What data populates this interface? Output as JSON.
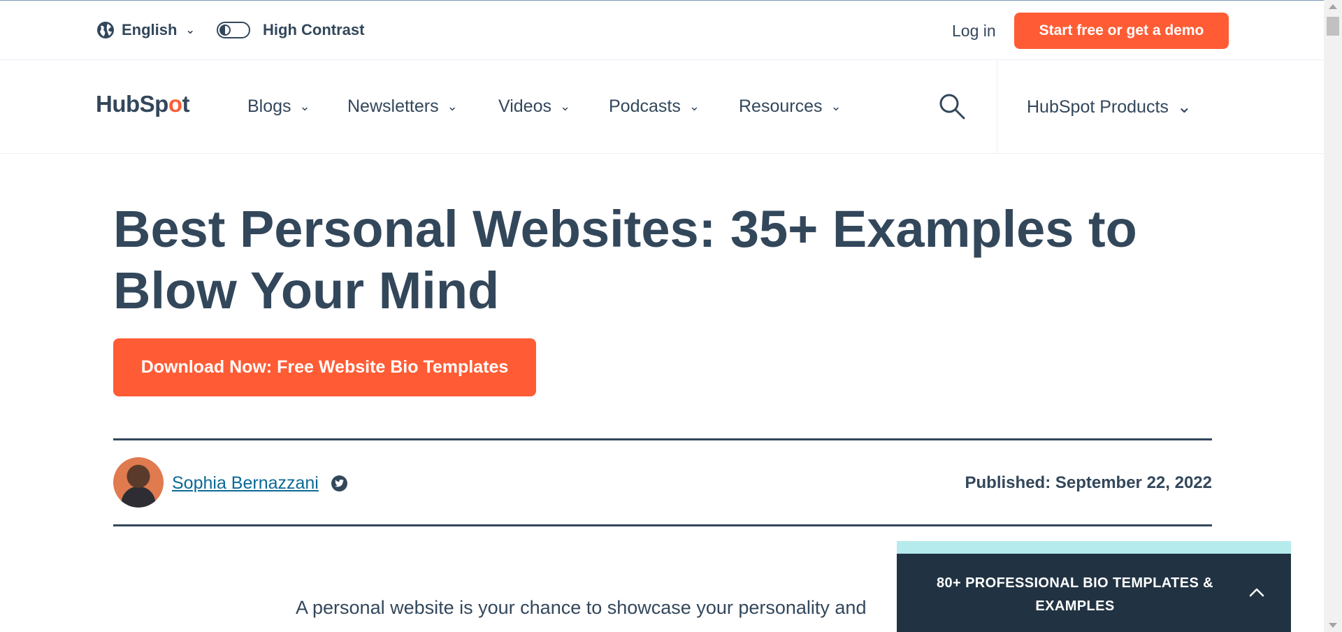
{
  "utility_bar": {
    "language": "English",
    "high_contrast": "High Contrast",
    "login": "Log in",
    "cta": "Start free or get a demo"
  },
  "nav": {
    "logo_part1": "HubSp",
    "logo_part2": "o",
    "logo_part3": "t",
    "items": [
      {
        "label": "Blogs"
      },
      {
        "label": "Newsletters"
      },
      {
        "label": "Videos"
      },
      {
        "label": "Podcasts"
      },
      {
        "label": "Resources"
      }
    ],
    "products": "HubSpot Products"
  },
  "article": {
    "title": "Best Personal Websites: 35+ Examples to Blow Your Mind",
    "download_button": "Download Now: Free Website Bio Templates",
    "author": "Sophia Bernazzani",
    "published": "Published: September 22, 2022",
    "intro": "A personal website is your chance to showcase your personality and"
  },
  "sticky_card": {
    "title": "80+ PROFESSIONAL BIO TEMPLATES & EXAMPLES"
  },
  "colors": {
    "accent": "#ff5c35",
    "text": "#33475b",
    "link": "#0b6a96",
    "card": "#213343",
    "card_accent": "#b5ebec"
  }
}
